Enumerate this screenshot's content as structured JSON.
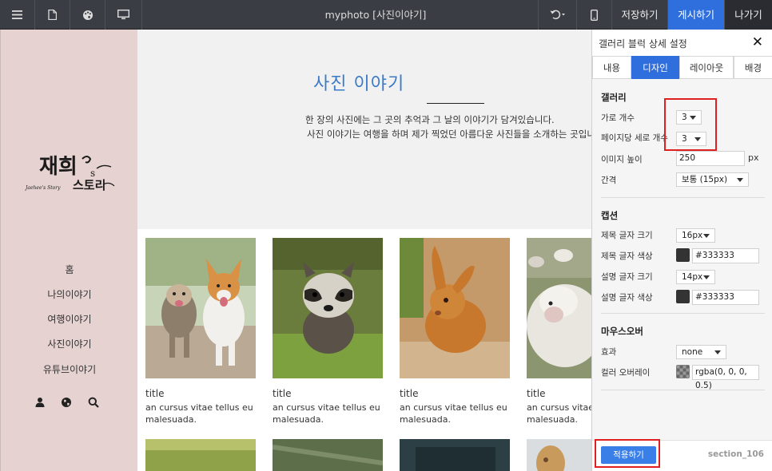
{
  "topbar": {
    "title": "myphoto [사진이야기]",
    "save_label": "저장하기",
    "publish_label": "게시하기",
    "exit_label": "나가기",
    "icons": [
      "menu-icon",
      "page-icon",
      "palette-icon",
      "desktop-icon",
      "undo-icon",
      "mobile-icon"
    ]
  },
  "sidebar": {
    "logo_text": "재희's",
    "logo_sub": "스토리",
    "logo_script": "Jaehee's Story",
    "nav": [
      {
        "label": "홈"
      },
      {
        "label": "나의이야기"
      },
      {
        "label": "여행이야기"
      },
      {
        "label": "사진이야기"
      },
      {
        "label": "유튜브이야기"
      }
    ],
    "icons": [
      "user-icon",
      "globe-icon",
      "search-icon"
    ]
  },
  "hero": {
    "title": "사진 이야기",
    "desc_line1": "한 장의 사진에는 그 곳의 추억과 그 날의 이야기가 담겨있습니다.",
    "desc_line2": "사진 이야기는 여행을 하며 제가 찍었던 아름다운 사진들을 소개하는 곳입니다."
  },
  "gallery": {
    "cards": [
      {
        "title": "title",
        "desc": "an cursus vitae tellus eu malesuada."
      },
      {
        "title": "title",
        "desc": "an cursus vitae tellus eu malesuada."
      },
      {
        "title": "title",
        "desc": "an cursus vitae tellus eu malesuada."
      },
      {
        "title": "title",
        "desc": "an cursus vitae tellus eu malesuada."
      }
    ]
  },
  "panel": {
    "title": "갤러리 블럭 상세 설정",
    "tabs": [
      {
        "label": "내용"
      },
      {
        "label": "디자인"
      },
      {
        "label": "레이아웃"
      },
      {
        "label": "배경"
      }
    ],
    "active_tab": "디자인",
    "gallery_section": {
      "title": "갤러리",
      "cols_label": "가로 개수",
      "cols_value": "3",
      "rows_label": "페이지당 세로 개수",
      "rows_value": "3",
      "img_height_label": "이미지 높이",
      "img_height_value": "250",
      "img_height_unit": "px",
      "gap_label": "간격",
      "gap_value": "보통 (15px)"
    },
    "caption_section": {
      "title": "캡션",
      "title_size_label": "제목 글자 크기",
      "title_size_value": "16px",
      "title_color_label": "제목 글자 색상",
      "title_color_value": "#333333",
      "desc_size_label": "설명 글자 크기",
      "desc_size_value": "14px",
      "desc_color_label": "설명 글자 색상",
      "desc_color_value": "#333333"
    },
    "hover_section": {
      "title": "마우스오버",
      "effect_label": "효과",
      "effect_value": "none",
      "overlay_label": "컬러 오버레이",
      "overlay_value": "rgba(0, 0, 0, 0.5)"
    },
    "apply_label": "적용하기",
    "section_id": "section_106"
  },
  "colors": {
    "topbar_bg": "#3a3d43",
    "accent": "#2f6fdd",
    "sidebar_bg": "#e6d2d1",
    "hero_title": "#3b7ac8",
    "highlight_box": "#e02020"
  }
}
